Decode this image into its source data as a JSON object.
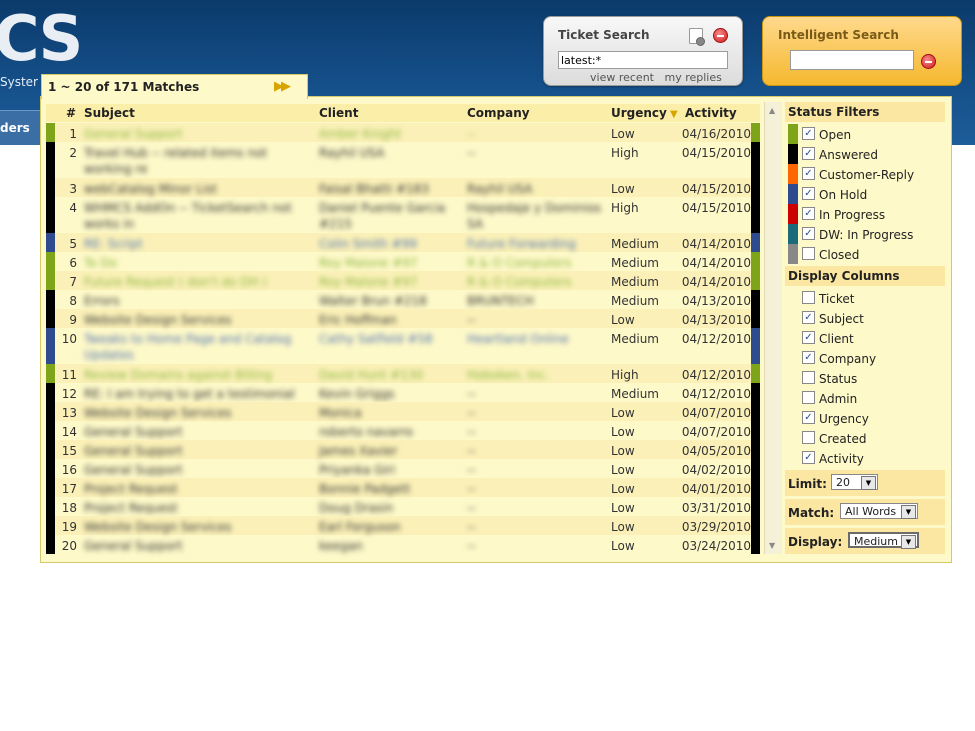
{
  "header": {
    "logo_text": "CS",
    "brand_sub": "Syster",
    "nav_label": "ders"
  },
  "ticket_search": {
    "title": "Ticket Search",
    "value": "latest:*",
    "link_recent": "view recent",
    "link_replies": "my replies"
  },
  "intelligent_search": {
    "title": "Intelligent Search",
    "value": ""
  },
  "results": {
    "label": "1 ~ 20 of 171 Matches",
    "next_icon": "▶▶"
  },
  "columns": {
    "num": "#",
    "subject": "Subject",
    "client": "Client",
    "company": "Company",
    "urgency": "Urgency",
    "activity": "Activity"
  },
  "colors": {
    "open": "#7ea41a",
    "answered": "#000000",
    "customer_reply": "#ff6600",
    "on_hold": "#2f4b8f",
    "in_progress": "#cc0000",
    "dw_in_progress": "#1a6a7a",
    "closed": "#888888"
  },
  "rows": [
    {
      "num": "1",
      "subject": "General Support",
      "client": "Amber Knight",
      "company": "--",
      "urgency": "Low",
      "activity": "04/16/2010",
      "status": "open"
    },
    {
      "num": "2",
      "subject": "Travel Hub -- related items not working re",
      "client": "Rayhil USA",
      "company": "--",
      "urgency": "High",
      "activity": "04/15/2010",
      "status": "answered"
    },
    {
      "num": "3",
      "subject": "webCatalog Minor List",
      "client": "Faisal Bhatti #183",
      "company": "Rayhil USA",
      "urgency": "Low",
      "activity": "04/15/2010",
      "status": "answered"
    },
    {
      "num": "4",
      "subject": "WHMCS AddOn -- TicketSearch not works in",
      "client": "Daniel Puente Garcia #215",
      "company": "Hospedaje y Dominios SA",
      "urgency": "High",
      "activity": "04/15/2010",
      "status": "answered"
    },
    {
      "num": "5",
      "subject": "RE: Script",
      "client": "Colin Smith #99",
      "company": "Future Forwarding",
      "urgency": "Medium",
      "activity": "04/14/2010",
      "status": "on_hold"
    },
    {
      "num": "6",
      "subject": "To Do",
      "client": "Roy Malone #97",
      "company": "R & O Computers",
      "urgency": "Medium",
      "activity": "04/14/2010",
      "status": "open"
    },
    {
      "num": "7",
      "subject": "Future Request ( don't do DH )",
      "client": "Roy Malone #97",
      "company": "R & O Computers",
      "urgency": "Medium",
      "activity": "04/14/2010",
      "status": "open"
    },
    {
      "num": "8",
      "subject": "Errors",
      "client": "Walter Brun #218",
      "company": "BRUNTECH",
      "urgency": "Medium",
      "activity": "04/13/2010",
      "status": "answered"
    },
    {
      "num": "9",
      "subject": "Website Design Services",
      "client": "Eric Hoffman",
      "company": "--",
      "urgency": "Low",
      "activity": "04/13/2010",
      "status": "answered"
    },
    {
      "num": "10",
      "subject": "Tweaks to Home Page and Catalog Updates",
      "client": "Cathy Satfield #58",
      "company": "Heartland Online",
      "urgency": "Medium",
      "activity": "04/12/2010",
      "status": "on_hold"
    },
    {
      "num": "11",
      "subject": "Review Domains against Billing",
      "client": "David Hunt #130",
      "company": "Hoboken, Inc.",
      "urgency": "High",
      "activity": "04/12/2010",
      "status": "open"
    },
    {
      "num": "12",
      "subject": "RE: I am trying to get a testimonial tag",
      "client": "Kevin Griggs",
      "company": "--",
      "urgency": "Medium",
      "activity": "04/12/2010",
      "status": "answered"
    },
    {
      "num": "13",
      "subject": "Website Design Services",
      "client": "Monica",
      "company": "--",
      "urgency": "Low",
      "activity": "04/07/2010",
      "status": "answered"
    },
    {
      "num": "14",
      "subject": "General Support",
      "client": "roberto navarro",
      "company": "--",
      "urgency": "Low",
      "activity": "04/07/2010",
      "status": "answered"
    },
    {
      "num": "15",
      "subject": "General Support",
      "client": "James Xavier",
      "company": "--",
      "urgency": "Low",
      "activity": "04/05/2010",
      "status": "answered"
    },
    {
      "num": "16",
      "subject": "General Support",
      "client": "Priyanka Giri",
      "company": "--",
      "urgency": "Low",
      "activity": "04/02/2010",
      "status": "answered"
    },
    {
      "num": "17",
      "subject": "Project Request",
      "client": "Bonnie Padgett",
      "company": "--",
      "urgency": "Low",
      "activity": "04/01/2010",
      "status": "answered"
    },
    {
      "num": "18",
      "subject": "Project Request",
      "client": "Doug Drasin",
      "company": "--",
      "urgency": "Low",
      "activity": "03/31/2010",
      "status": "answered"
    },
    {
      "num": "19",
      "subject": "Website Design Services",
      "client": "Earl Ferguson",
      "company": "--",
      "urgency": "Low",
      "activity": "03/29/2010",
      "status": "answered"
    },
    {
      "num": "20",
      "subject": "General Support",
      "client": "keegan",
      "company": "--",
      "urgency": "Low",
      "activity": "03/24/2010",
      "status": "answered"
    }
  ],
  "sidebar": {
    "status_filters_title": "Status Filters",
    "status_filters": [
      {
        "label": "Open",
        "checked": true,
        "key": "open"
      },
      {
        "label": "Answered",
        "checked": true,
        "key": "answered"
      },
      {
        "label": "Customer-Reply",
        "checked": true,
        "key": "customer_reply"
      },
      {
        "label": "On Hold",
        "checked": true,
        "key": "on_hold"
      },
      {
        "label": "In Progress",
        "checked": true,
        "key": "in_progress"
      },
      {
        "label": "DW: In Progress",
        "checked": true,
        "key": "dw_in_progress"
      },
      {
        "label": "Closed",
        "checked": false,
        "key": "closed"
      }
    ],
    "display_columns_title": "Display Columns",
    "display_columns": [
      {
        "label": "Ticket",
        "checked": false
      },
      {
        "label": "Subject",
        "checked": true
      },
      {
        "label": "Client",
        "checked": true
      },
      {
        "label": "Company",
        "checked": true
      },
      {
        "label": "Status",
        "checked": false
      },
      {
        "label": "Admin",
        "checked": false
      },
      {
        "label": "Urgency",
        "checked": true
      },
      {
        "label": "Created",
        "checked": false
      },
      {
        "label": "Activity",
        "checked": true
      }
    ],
    "limit_label": "Limit:",
    "limit_value": "20",
    "match_label": "Match:",
    "match_value": "All Words",
    "display_label": "Display:",
    "display_value": "Medium"
  }
}
